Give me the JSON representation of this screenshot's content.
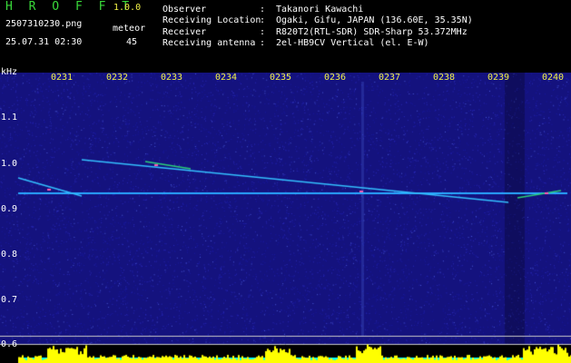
{
  "header": {
    "app_name": "H R O F F T",
    "version": "1.0.0",
    "file_name": "2507310230.png",
    "meteor_label": "meteor",
    "datetime": "25.07.31 02:30",
    "meteor_count": "45",
    "info": [
      {
        "label": "Observer",
        "value": "Takanori Kawachi"
      },
      {
        "label": "Receiving Location",
        "value": "Ogaki, Gifu, JAPAN (136.60E, 35.35N)"
      },
      {
        "label": "Receiver",
        "value": "R820T2(RTL-SDR) SDR-Sharp 53.372MHz"
      },
      {
        "label": "Receiving antenna",
        "value": "2el-HB9CV Vertical (el. E-W)"
      }
    ],
    "separator": ":"
  },
  "spectrogram": {
    "unit_label": "kHz",
    "time_ticks": [
      "0231",
      "0232",
      "0233",
      "0234",
      "0235",
      "0236",
      "0237",
      "0238",
      "0239",
      "0240"
    ],
    "freq_ticks": [
      "1.1",
      "1.0",
      "0.9",
      "0.8",
      "0.7",
      "0.6"
    ],
    "colors": {
      "background": "#14127e",
      "noise": "#2a2ab8",
      "carrier": "#29a8ff",
      "strong": "#ff5ab0",
      "histogram": "#ffff00",
      "baseline": "#00ffff",
      "guide_line": "#c8c8c8"
    }
  }
}
